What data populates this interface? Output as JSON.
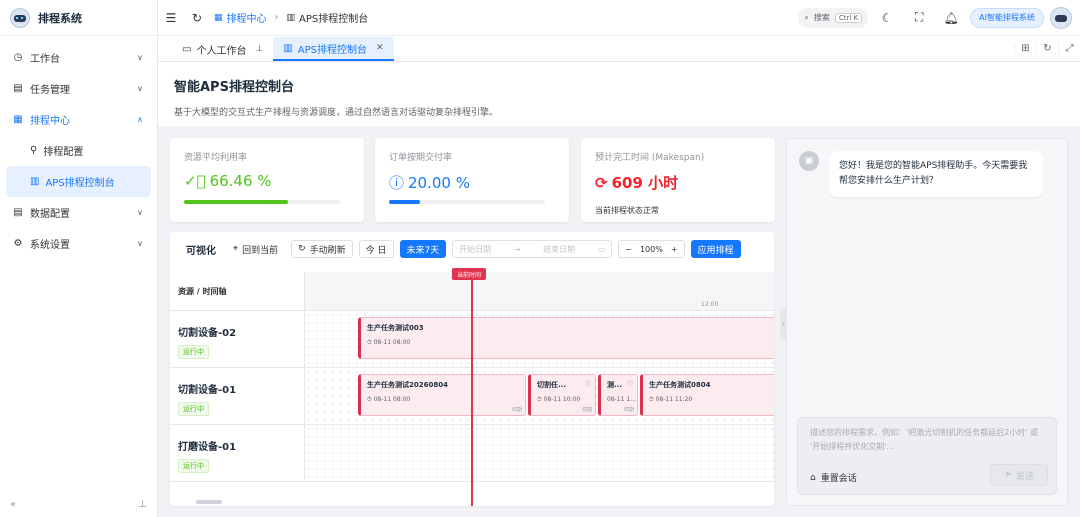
{
  "app": {
    "title": "排程系统"
  },
  "sidebar": {
    "items": [
      {
        "label": "工作台",
        "icon": "dashboard-icon"
      },
      {
        "label": "任务管理",
        "icon": "task-icon"
      },
      {
        "label": "排程中心",
        "icon": "schedule-icon"
      },
      {
        "label": "数据配置",
        "icon": "data-icon"
      },
      {
        "label": "系统设置",
        "icon": "gear-icon"
      }
    ],
    "sub_items": [
      {
        "label": "排程配置",
        "icon": "link-icon"
      },
      {
        "label": "APS排程控制台",
        "icon": "console-icon"
      }
    ],
    "collapse_icon": "«",
    "pin_icon": "pin-icon"
  },
  "header": {
    "breadcrumb": [
      "排程中心",
      "APS排程控制台"
    ],
    "search_label": "搜索",
    "search_shortcut": "Ctrl K",
    "ai_button": "AI智能排程系统"
  },
  "tabs": [
    {
      "label": "个人工作台"
    },
    {
      "label": "APS排程控制台"
    }
  ],
  "page": {
    "title": "智能APS排程控制台",
    "description": "基于大模型的交互式生产排程与资源调度，通过自然语言对话驱动复杂排程引擎。"
  },
  "kpis": {
    "utilization": {
      "label": "资源平均利用率",
      "value": "66.46 %",
      "fraction": 0.6646,
      "color": "#52c41a"
    },
    "ontime": {
      "label": "订单按期交付率",
      "value": "20.00 %",
      "fraction": 0.2,
      "color": "#1677ff"
    },
    "makespan": {
      "label": "预计完工时间 (Makespan)",
      "value": "609 小时",
      "sub": "当前排程状态正常",
      "color": "#f5222d"
    }
  },
  "gantt": {
    "title": "可视化",
    "btn_now": "回到当前",
    "btn_refresh": "手动刷新",
    "btn_today": "今 日",
    "btn_7days": "未来7天",
    "start_placeholder": "开始日期",
    "end_placeholder": "结束日期",
    "zoom": "100%",
    "btn_apply": "应用排程",
    "col_header": "资源 / 时间轴",
    "tick_label": "12:00",
    "now_label": "当前时间",
    "resources": [
      {
        "name": "切割设备-02",
        "status": "运行中"
      },
      {
        "name": "切割设备-01",
        "status": "运行中"
      },
      {
        "name": "打磨设备-01",
        "status": "运行中"
      }
    ],
    "tasks": [
      {
        "name": "生产任务测试003",
        "time": "08-11 08:00",
        "tag": ""
      },
      {
        "name": "生产任务测试20260804",
        "time": "08-11 08:00",
        "tag": "切割"
      },
      {
        "name": "切割任...",
        "time": "08-11 10:00",
        "tag": "切割"
      },
      {
        "name": "测...",
        "time": "08-11 1...",
        "tag": "切割"
      },
      {
        "name": "生产任务测试0804",
        "time": "08-11 11:20",
        "tag": ""
      }
    ]
  },
  "chat": {
    "greeting": "您好！我是您的智能APS排程助手。今天需要我帮您安排什么生产计划？",
    "placeholder": "描述您的排程需求，例如：'把激光切割机的任务都延后2小时' 或 '开始排程并优化交期'...",
    "reset_label": "重置会话",
    "send_label": "发送"
  }
}
